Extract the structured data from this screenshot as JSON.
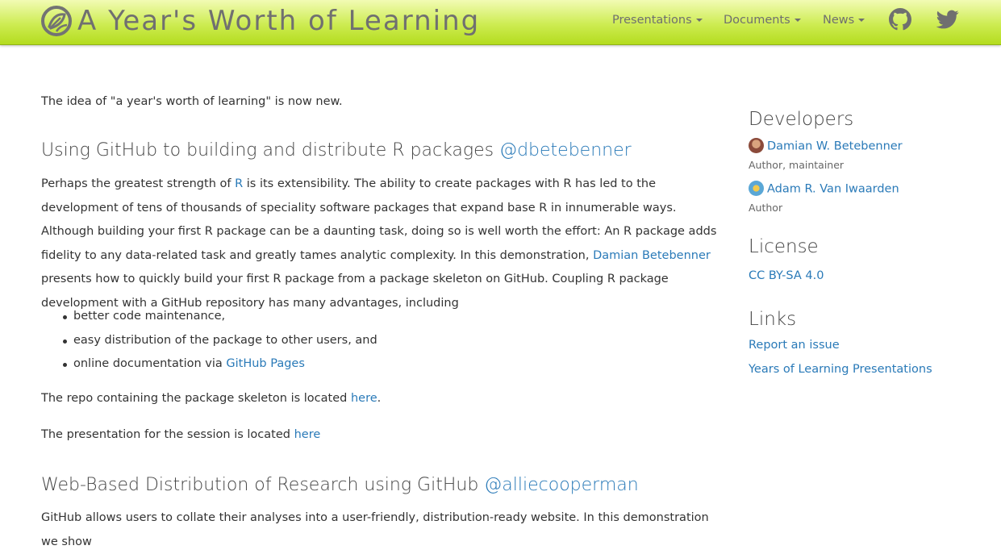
{
  "header": {
    "title": "A Year's Worth of Learning",
    "nav": [
      {
        "label": "Presentations"
      },
      {
        "label": "Documents"
      },
      {
        "label": "News"
      }
    ],
    "icons": [
      "github-icon",
      "twitter-icon"
    ]
  },
  "main": {
    "intro": "The idea of \"a year's worth of learning\" is now new.",
    "section1": {
      "heading": "Using GitHub to building and distribute R packages ",
      "handle": "@dbetebenner",
      "p1_a": "Perhaps the greatest strength of ",
      "p1_link_r": "R",
      "p1_b": " is its extensibility. The ability to create packages with R has led to the development of tens of thousands of speciality software packages that expand base R in innumerable ways. Although building your first R package can be a daunting task, doing so is well worth the effort: An R package adds fidelity to any data-related task and greatly tames analytic complexity. In this demonstration, ",
      "p1_link_name": "Damian Betebenner",
      "p1_c": " presents how to quickly build your first R package from a package skeleton on GitHub. Coupling R package development with a GitHub repository has many advantages, including",
      "bullets": [
        "better code maintenance,",
        "easy distribution of the package to other users, and",
        "online documentation via "
      ],
      "bullet3_link": "GitHub Pages",
      "repo_text": "The repo containing the package skeleton is located ",
      "repo_link": "here",
      "repo_end": ".",
      "pres_text": "The presentation for the session is located ",
      "pres_link": "here"
    },
    "section2": {
      "heading": "Web-Based Distribution of Research using GitHub ",
      "handle": "@alliecooperman",
      "p1": "GitHub allows users to collate their analyses into a user-friendly, distribution-ready website. In this demonstration we show"
    }
  },
  "sidebar": {
    "developers_heading": "Developers",
    "developers": [
      {
        "name": "Damian W. Betebenner",
        "role": "Author, maintainer"
      },
      {
        "name": "Adam R. Van Iwaarden",
        "role": "Author"
      }
    ],
    "license_heading": "License",
    "license": "CC BY-SA 4.0",
    "links_heading": "Links",
    "links": [
      "Report an issue",
      "Years of Learning Presentations"
    ]
  },
  "colors": {
    "navbar": "#c9ea4a",
    "link": "#2a7ab8",
    "text": "#333333"
  }
}
